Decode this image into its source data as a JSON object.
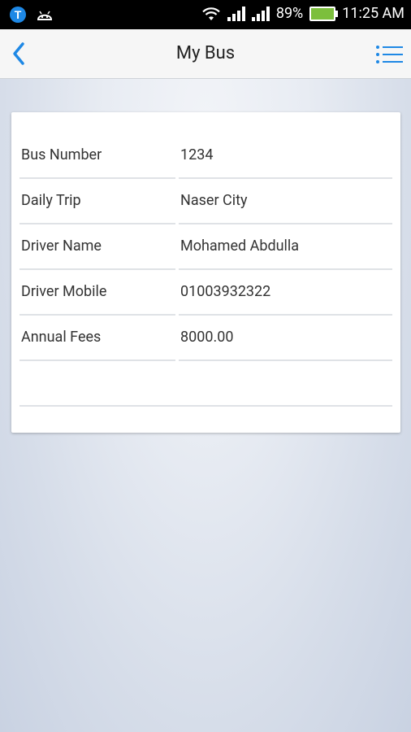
{
  "statusbar": {
    "battery": "89%",
    "time": "11:25 AM"
  },
  "appbar": {
    "title": "My Bus"
  },
  "details": [
    {
      "label": "Bus Number",
      "value": "1234"
    },
    {
      "label": "Daily Trip",
      "value": "Naser City"
    },
    {
      "label": "Driver Name",
      "value": "Mohamed Abdulla"
    },
    {
      "label": "Driver Mobile",
      "value": "01003932322"
    },
    {
      "label": "Annual Fees",
      "value": "8000.00"
    },
    {
      "label": "",
      "value": ""
    }
  ],
  "colors": {
    "accent": "#1e88e5",
    "appbar_bg": "#f6f6f6",
    "statusbar_bg": "#000000"
  }
}
